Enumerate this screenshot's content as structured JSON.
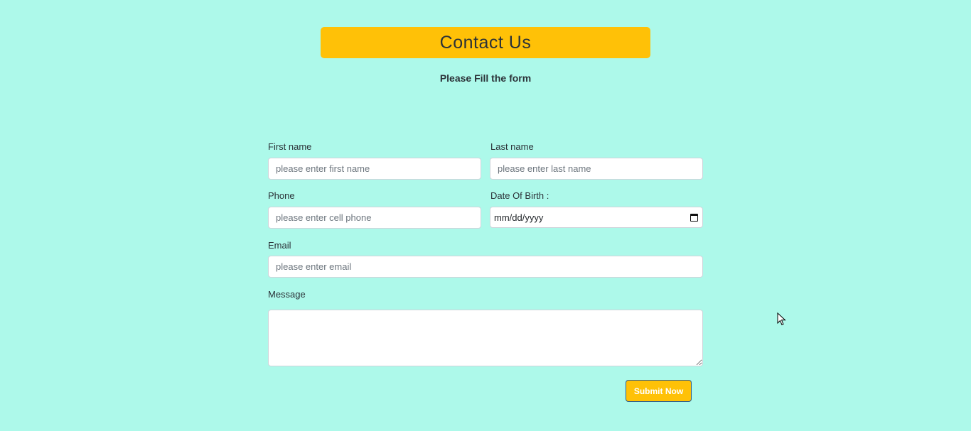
{
  "header": {
    "title": "Contact Us",
    "subtitle": "Please Fill the form"
  },
  "form": {
    "first_name": {
      "label": "First name",
      "placeholder": "please enter first name",
      "value": ""
    },
    "last_name": {
      "label": "Last name",
      "placeholder": "please enter last name",
      "value": ""
    },
    "phone": {
      "label": "Phone",
      "placeholder": "please enter cell phone",
      "value": ""
    },
    "dob": {
      "label": "Date Of Birth :",
      "value": "mm/dd/yyyy",
      "icon": "calendar-icon"
    },
    "email": {
      "label": "Email",
      "placeholder": "please enter email",
      "value": ""
    },
    "message": {
      "label": "Message",
      "placeholder": "",
      "value": ""
    },
    "submit_label": "Submit Now"
  },
  "colors": {
    "background": "#adf9ea",
    "accent": "#ffc107",
    "text": "#2b3238"
  }
}
